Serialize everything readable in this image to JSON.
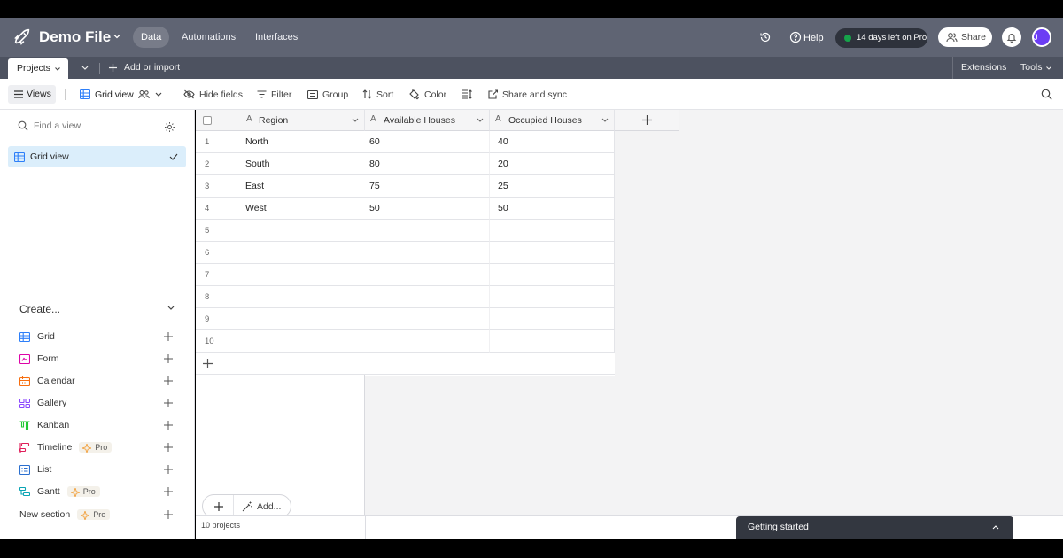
{
  "header": {
    "app_title": "Demo File",
    "nav": [
      "Data",
      "Automations",
      "Interfaces"
    ],
    "help_label": "Help",
    "trial_label": "14 days left on Pro",
    "share_label": "Share",
    "avatar_initial": "J"
  },
  "tablebar": {
    "table_tab": "Projects",
    "add_import": "Add or import",
    "extensions": "Extensions",
    "tools": "Tools"
  },
  "toolbar": {
    "views": "Views",
    "view_name": "Grid view",
    "hide_fields": "Hide fields",
    "filter": "Filter",
    "group": "Group",
    "sort": "Sort",
    "color": "Color",
    "share_sync": "Share and sync"
  },
  "sidebar": {
    "find_placeholder": "Find a view",
    "active_view": "Grid view",
    "create_label": "Create...",
    "create_items": [
      {
        "label": "Grid",
        "icon": "grid-icon",
        "color": "#2d7ff9"
      },
      {
        "label": "Form",
        "icon": "form-icon",
        "color": "#dd04a8"
      },
      {
        "label": "Calendar",
        "icon": "calendar-icon",
        "color": "#f76e0f"
      },
      {
        "label": "Gallery",
        "icon": "gallery-icon",
        "color": "#8b46ff"
      },
      {
        "label": "Kanban",
        "icon": "kanban-icon",
        "color": "#20c933"
      },
      {
        "label": "Timeline",
        "icon": "timeline-icon",
        "color": "#e01e5a",
        "badge": "Pro"
      },
      {
        "label": "List",
        "icon": "list-icon",
        "color": "#2b6fcf"
      },
      {
        "label": "Gantt",
        "icon": "gantt-icon",
        "color": "#0aa4b4",
        "badge": "Pro"
      },
      {
        "label": "New section",
        "icon": "",
        "color": "",
        "badge": "Pro"
      }
    ]
  },
  "grid": {
    "columns": [
      "Region",
      "Available Houses",
      "Occupied Houses"
    ],
    "rows": [
      {
        "num": "1",
        "region": "North",
        "available": "60",
        "occupied": "40"
      },
      {
        "num": "2",
        "region": "South",
        "available": "80",
        "occupied": "20"
      },
      {
        "num": "3",
        "region": "East",
        "available": "75",
        "occupied": "25"
      },
      {
        "num": "4",
        "region": "West",
        "available": "50",
        "occupied": "50"
      },
      {
        "num": "5",
        "region": "",
        "available": "",
        "occupied": ""
      },
      {
        "num": "6",
        "region": "",
        "available": "",
        "occupied": ""
      },
      {
        "num": "7",
        "region": "",
        "available": "",
        "occupied": ""
      },
      {
        "num": "8",
        "region": "",
        "available": "",
        "occupied": ""
      },
      {
        "num": "9",
        "region": "",
        "available": "",
        "occupied": ""
      },
      {
        "num": "10",
        "region": "",
        "available": "",
        "occupied": ""
      }
    ],
    "add_label": "Add...",
    "record_count": "10 projects"
  },
  "getting_started": "Getting started"
}
